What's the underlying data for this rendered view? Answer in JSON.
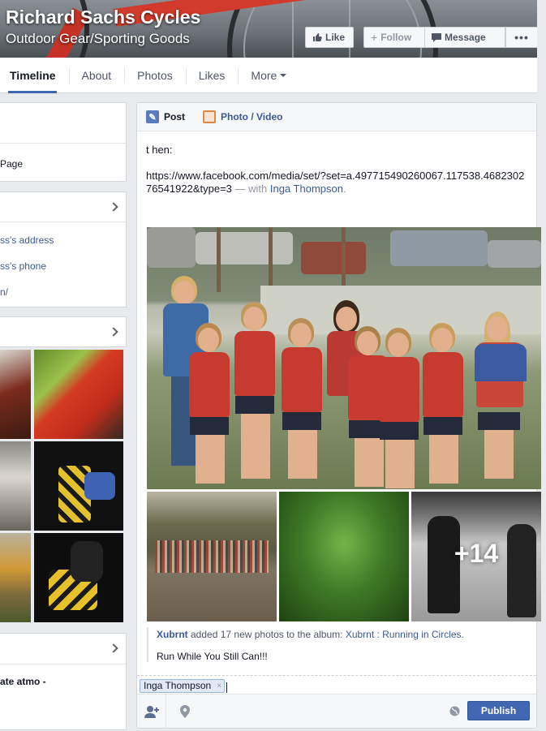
{
  "cover": {
    "title": "Richard Sachs Cycles",
    "subtitle": "Outdoor Gear/Sporting Goods",
    "buttons": {
      "like": "Like",
      "follow": "Follow",
      "message": "Message",
      "more": "•••"
    }
  },
  "tabs": [
    {
      "label": "Timeline",
      "active": true
    },
    {
      "label": "About"
    },
    {
      "label": "Photos"
    },
    {
      "label": "Likes"
    },
    {
      "label": "More"
    }
  ],
  "left": {
    "box1": {
      "item": "Page"
    },
    "about": {
      "links": [
        "ss's address",
        "ss's phone",
        "n/"
      ]
    },
    "about_partial": "",
    "bottom_text": "ate atmo -"
  },
  "composer": {
    "tabs": {
      "post": "Post",
      "photo_video": "Photo / Video"
    },
    "text_line1": "t hen:",
    "url_line": "https://www.facebook.com/media/set/?set=a.497715490260067.117538.468230276541922&type=3",
    "with_prefix": " — with ",
    "with_name": "Inga Thompson",
    "with_suffix": ".",
    "more_count": "+14",
    "share_actor": "Xubrnt",
    "share_action": " added 17 new photos to the album: ",
    "share_album": "Xubrnt : Running in Circles",
    "share_end": ".",
    "share_caption": "Run While You Still Can!!!",
    "tag_name": "Inga Thompson",
    "tag_remove": "×",
    "publish": "Publish"
  },
  "colors": {
    "accent": "#4267b2",
    "link": "#3b5998",
    "background": "#e9eaed"
  }
}
